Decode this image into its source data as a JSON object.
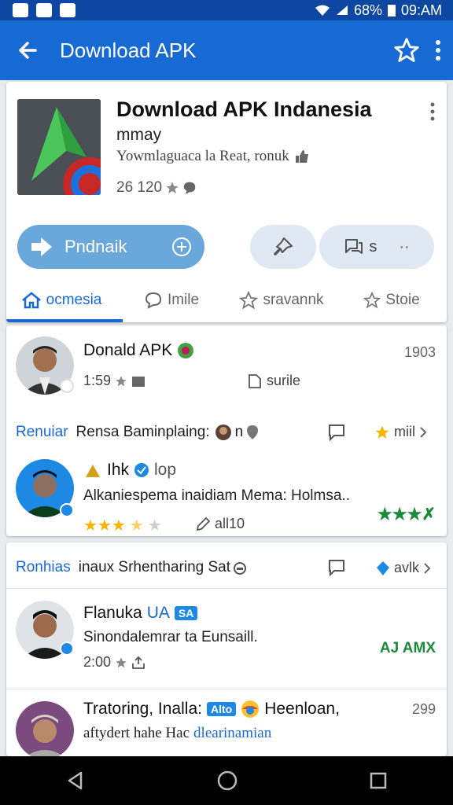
{
  "status_bar": {
    "battery": "68%",
    "time": "09:AM"
  },
  "app_bar": {
    "title": "Download APK"
  },
  "app": {
    "name": "Download APK Indanesia",
    "developer": "mmay",
    "description": "Yowmlaguaca la Reat, ronuk",
    "rating": "26 120",
    "install_label": "Pndnaik",
    "share_label": "s"
  },
  "tabs": [
    {
      "label": "ocmesia"
    },
    {
      "label": "Imile"
    },
    {
      "label": "sravannk"
    },
    {
      "label": "Stoie"
    }
  ],
  "card2": {
    "row1": {
      "title": "Donald APK",
      "time": "1:59",
      "sub_label": "surile",
      "count": "1903"
    },
    "section": {
      "link": "Renuiar",
      "text": "Rensa Baminplaing:",
      "suffix": "n",
      "right": "miil"
    },
    "row2": {
      "title": "Ihk",
      "tag": "lop",
      "text": "Alkaniespema inaidiam Mema: Holmsa..",
      "action": "all10"
    }
  },
  "card3": {
    "section": {
      "link": "Ronhias",
      "text": "inaux Srhentharing Sat",
      "right": "avlk"
    },
    "row1": {
      "title": "Flanuka",
      "tag_blue": "UA",
      "tag_badge": "SA",
      "text": "Sinondalemrar ta Eunsaill.",
      "time": "2:00",
      "right": "AJ AMX"
    },
    "row2": {
      "title": "Tratoring, Inalla:",
      "badge": "Alto",
      "title_suffix": "Heenloan,",
      "count": "299",
      "text": "aftydert hahe Hac",
      "text_link": "dlearinamian"
    }
  },
  "colors": {
    "primary": "#1769d3",
    "status": "#0d47a1",
    "install": "#6aa8dc",
    "green": "#1b8a3a",
    "star": "#f4b400"
  }
}
